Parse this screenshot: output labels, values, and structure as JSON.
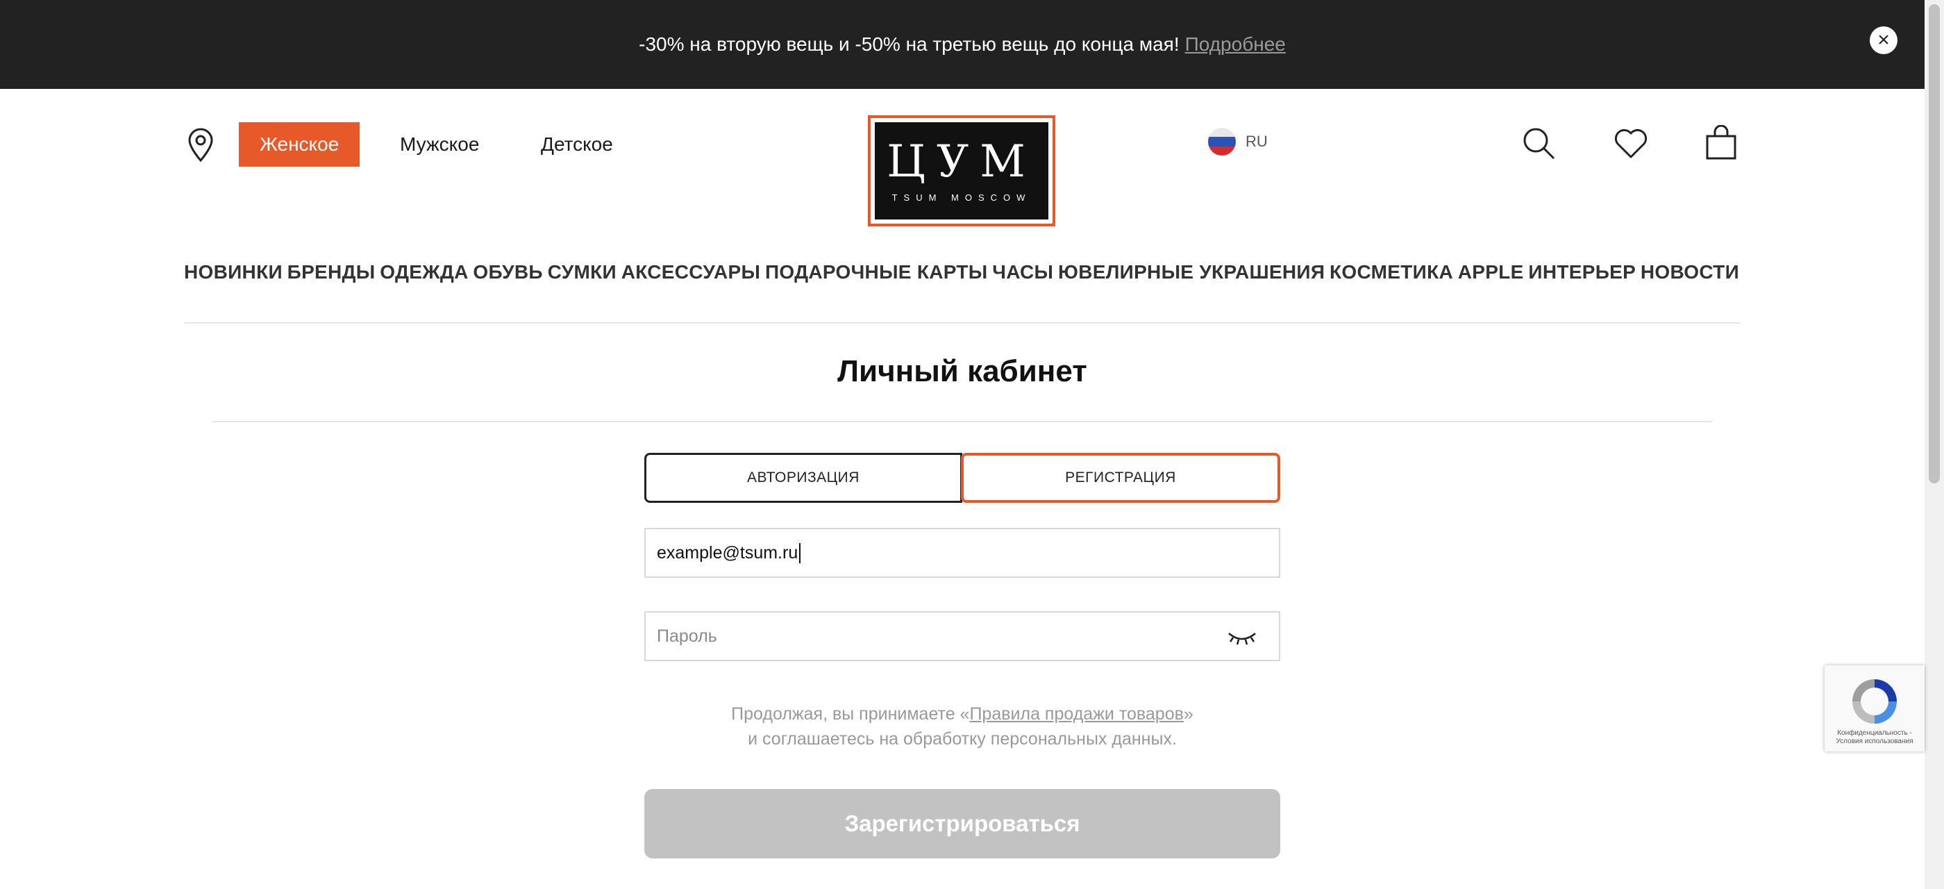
{
  "promo": {
    "text": "-30% на вторую вещь и -50% на третью вещь до конца мая!",
    "link": "Подробнее",
    "close_glyph": "×"
  },
  "header": {
    "genders": [
      "Женское",
      "Мужское",
      "Детское"
    ],
    "active_gender": "Женское",
    "logo_main": "ЦУМ",
    "logo_sub": "TSUM MOSCOW",
    "language": "RU",
    "icons": [
      "location-icon",
      "search-icon",
      "heart-icon",
      "bag-icon"
    ]
  },
  "nav": {
    "items": [
      "НОВИНКИ",
      "БРЕНДЫ",
      "ОДЕЖДА",
      "ОБУВЬ",
      "СУМКИ",
      "АКСЕССУАРЫ",
      "ПОДАРОЧНЫЕ КАРТЫ",
      "ЧАСЫ",
      "ЮВЕЛИРНЫЕ УКРАШЕНИЯ",
      "КОСМЕТИКА",
      "APPLE",
      "ИНТЕРЬЕР",
      "НОВОСТИ"
    ]
  },
  "page": {
    "title": "Личный кабинет",
    "tabs": [
      "АВТОРИЗАЦИЯ",
      "РЕГИСТРАЦИЯ"
    ],
    "active_tab": "РЕГИСТРАЦИЯ",
    "email_value": "example@tsum.ru",
    "password_placeholder": "Пароль",
    "consent_prefix": "Продолжая, вы принимаете «",
    "consent_link": "Правила продажи товаров",
    "consent_suffix": "»",
    "consent_line2": "и соглашаетесь на обработку персональных данных.",
    "submit_label": "Зарегистрироваться"
  },
  "recaptcha": {
    "text_line1": "Конфиденциальность -",
    "text_line2": "Условия использования"
  },
  "colors": {
    "accent": "#e8592a",
    "promo_bg": "#222222",
    "button_disabled": "#c2c2c2"
  }
}
